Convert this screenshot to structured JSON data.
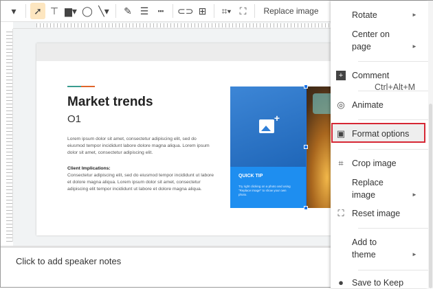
{
  "toolbar": {
    "replace_image": "Replace image"
  },
  "slide": {
    "title": "Market trends",
    "subtitle": "O1",
    "paragraph1": "Lorem ipsum dolor sit amet, consectetur adipiscing elit, sed do eiusmod tempor incididunt labore dolore magna aliqua. Lorem ipsum dolor sit amet, consectetur adipiscing elit.",
    "implications_heading": "Client Implications:",
    "paragraph2": "Consectetur adipiscing elit, sed do eiusmod tempor incididunt ut labore et dolore magna aliqua. Lorem ipsum dolor sit amet, consectetur adipiscing elit tempor incididunt ut labore et dolore magna aliqua.",
    "tip_heading": "QUICK TIP",
    "tip_text": "Try right clicking on a photo and using \"Replace image\" to show your own photo.",
    "accent_colors": [
      "#3a9c8f",
      "#e0652b"
    ]
  },
  "notes": {
    "placeholder": "Click to add speaker notes"
  },
  "menu": {
    "rotate": "Rotate",
    "center_on_page": "Center on page",
    "comment": "Comment",
    "comment_shortcut": "Ctrl+Alt+M",
    "animate": "Animate",
    "format_options": "Format options",
    "crop_image": "Crop image",
    "replace_image": "Replace image",
    "reset_image": "Reset image",
    "add_to_theme": "Add to theme",
    "save_to_keep": "Save to Keep",
    "highlight_color": "#d62633"
  }
}
